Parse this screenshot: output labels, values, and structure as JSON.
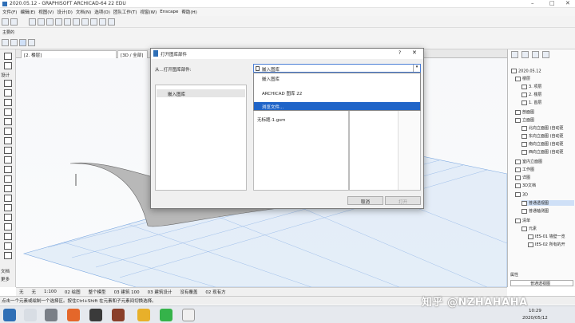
{
  "window": {
    "title": "2020.05.12 - GRAPHISOFT ARCHICAD-64 22 EDU"
  },
  "menu": [
    "文件(F)",
    "编辑(E)",
    "视图(V)",
    "设计(D)",
    "文档(N)",
    "选项(O)",
    "团队工作(T)",
    "视窗(W)",
    "Enscape",
    "帮助(H)"
  ],
  "toolbar": {
    "group_label": "主要的"
  },
  "tabs": [
    "[2. 楼层]",
    "[3D / 全部]"
  ],
  "toolbox": {
    "select_label": "设计",
    "doc_label": "文档",
    "more_label": "更多"
  },
  "dialog": {
    "title": "打开图库部件",
    "help": "?",
    "from_label": "从...打开图库部件:",
    "combo_value": "嵌入图库",
    "dropdown": [
      "嵌入图库",
      "ARCHICAD 图库 22",
      "浏览文件..."
    ],
    "left_item": "嵌入图库",
    "mid_item": "无标题-1.gsm",
    "cancel": "取消",
    "open": "打开"
  },
  "navigator": {
    "root": "2020.05.12",
    "items": [
      "楼层",
      "3. 项层",
      "2. 楼层",
      "1. 首层",
      "剖面图",
      "立面图",
      "北向立面图 (自动更",
      "东向立面图 (自动更",
      "南向立面图 (自动更",
      "西向立面图 (自动更",
      "室内立面图",
      "工作图",
      "详图",
      "3D文档",
      "3D",
      "普通透视图",
      "普通轴测图",
      "清单",
      "元素",
      "IES-01 墙壁一览",
      "IES-02 所有的开"
    ],
    "properties_label": "属性",
    "properties_value": "普通透视图"
  },
  "statusbar": [
    "无",
    "无",
    "1:100",
    "02 绘图",
    "整个模型",
    "03 建筑 100",
    "03 建筑设计",
    "没有覆盖",
    "02 现有方"
  ],
  "infobar": "点击一个元素或绘制一个选择区。按住Ctrl+Shift 在元素和子元素间切换选择。",
  "taskbar": {
    "time": "10:29",
    "date": "2020/05/12"
  },
  "watermark": "知乎 @NZHAHAHA",
  "colors": {
    "accent": "#2f6fb6",
    "selection": "#1f64c8",
    "grid": "#7aa7e0"
  }
}
